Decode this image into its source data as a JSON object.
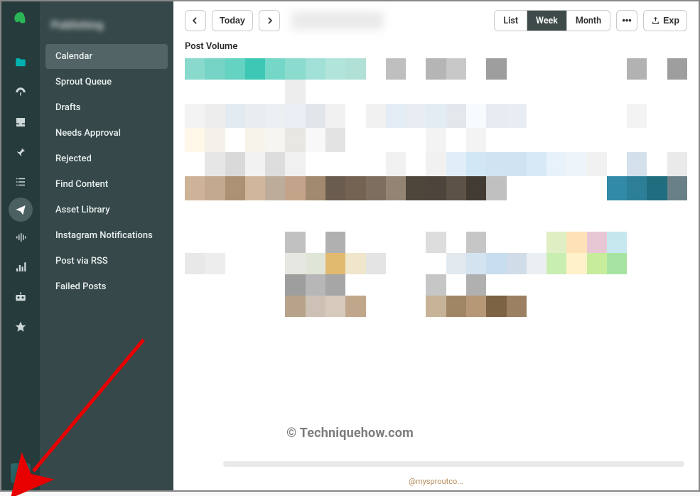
{
  "section_title": "Publishing",
  "sidebar": {
    "items": [
      {
        "label": "Calendar",
        "selected": true
      },
      {
        "label": "Sprout Queue"
      },
      {
        "label": "Drafts"
      },
      {
        "label": "Needs Approval"
      },
      {
        "label": "Rejected"
      },
      {
        "label": "Find Content"
      },
      {
        "label": "Asset Library"
      },
      {
        "label": "Instagram Notifications"
      },
      {
        "label": "Post via RSS"
      },
      {
        "label": "Failed Posts"
      }
    ]
  },
  "toolbar": {
    "today_label": "Today",
    "list_label": "List",
    "week_label": "Week",
    "month_label": "Month",
    "more_label": "•••",
    "export_label": "Exp"
  },
  "content": {
    "post_volume_label": "Post Volume",
    "footer_handle": "@mysproutco..."
  },
  "watermark": "© Techniquehow.com",
  "icon_rail": [
    "folder",
    "dashboard",
    "inbox",
    "pin",
    "list",
    "plane",
    "audio",
    "bars",
    "bot",
    "star"
  ],
  "pixels": [
    [
      "#8ad9cd",
      "#75d4c5",
      "#64d3c2",
      "#3cc8b4",
      "#74d7c8",
      "#8bdcce",
      "#a0e0d6",
      "#b1e4da",
      "#b1e0d6",
      "#ffffff",
      "#bfbfbf",
      "#ffffff",
      "#b5b5b5",
      "#c8c8c8",
      "#ffffff",
      "#9e9e9e",
      "#ffffff",
      "#ffffff",
      "#ffffff",
      "#ffffff",
      "#ffffff",
      "#ffffff",
      "#b2b2b2",
      "#ffffff",
      "#9e9e9e"
    ],
    [
      "#ffffff",
      "#ffffff",
      "#ffffff",
      "#ffffff",
      "#ffffff",
      "#ededed",
      "#ffffff",
      "#ffffff",
      "#ffffff",
      "#ffffff",
      "#ffffff",
      "#ffffff",
      "#ffffff",
      "#ffffff",
      "#ffffff",
      "#ffffff",
      "#ffffff",
      "#ffffff",
      "#ffffff",
      "#ffffff",
      "#ffffff",
      "#ffffff",
      "#ffffff",
      "#ffffff",
      "#ffffff"
    ],
    [
      "#f3f3f3",
      "#ededed",
      "#e2ebf2",
      "#e9edf1",
      "#edf0f2",
      "#e9eff4",
      "#e2e6ea",
      "#f1f1f1",
      "#ffffff",
      "#f1f1f1",
      "#e4edf5",
      "#e7edf2",
      "#e4ecf3",
      "#e3e8ed",
      "#f7fbfd",
      "#e6ecf1",
      "#e7edf2",
      "#ffffff",
      "#ffffff",
      "#ffffff",
      "#ffffff",
      "#ffffff",
      "#f3f3f3",
      "#ffffff",
      "#ffffff"
    ],
    [
      "#fff7e8",
      "#f4f0ea",
      "#ffffff",
      "#f7f3ea",
      "#f6f5f1",
      "#e8e7e3",
      "#f8f8f8",
      "#e3e3e3",
      "#ffffff",
      "#ffffff",
      "#ffffff",
      "#ffffff",
      "#f3f3f3",
      "#ffffff",
      "#f3f3f3",
      "#ffffff",
      "#ffffff",
      "#ffffff",
      "#ffffff",
      "#ffffff",
      "#ffffff",
      "#ffffff",
      "#ffffff",
      "#ffffff",
      "#ffffff"
    ],
    [
      "#ffffff",
      "#e6e6e6",
      "#d9d9d9",
      "#f2f2f2",
      "#dddddd",
      "#f0f0f0",
      "#ffffff",
      "#ffffff",
      "#ffffff",
      "#ffffff",
      "#f1f1f1",
      "#ffffff",
      "#f1f1f1",
      "#e1eef8",
      "#d2e7f6",
      "#cfe3f3",
      "#cfe3f3",
      "#d7e9f7",
      "#e8f2fb",
      "#eef5fa",
      "#f1f1f1",
      "#ffffff",
      "#d4e0eb",
      "#ffffff",
      "#eaeaea"
    ],
    [
      "#cfb399",
      "#c2a98f",
      "#ad9175",
      "#d0b79c",
      "#beac9a",
      "#c3a48a",
      "#a18a6f",
      "#6a5c4e",
      "#746252",
      "#7e6e5f",
      "#948473",
      "#4f463b",
      "#4d443b",
      "#5d5246",
      "#423b34",
      "#c0c0c0",
      "#ffffff",
      "#ffffff",
      "#ffffff",
      "#ffffff",
      "#ffffff",
      "#308aa8",
      "#2d7f98",
      "#206d7f",
      "#6a8087"
    ],
    [
      "#ffffff",
      "#ffffff",
      "#ffffff",
      "#ffffff",
      "#ffffff",
      "#ffffff",
      "#ffffff",
      "#ffffff",
      "#ffffff",
      "#ffffff",
      "#ffffff",
      "#ffffff",
      "#ffffff",
      "#ffffff",
      "#ffffff",
      "#ffffff",
      "#ffffff",
      "#ffffff",
      "#ffffff",
      "#ffffff",
      "#ffffff",
      "#ffffff",
      "#ffffff",
      "#ffffff",
      "#ffffff"
    ],
    [
      "#ffffff",
      "#ffffff",
      "#ffffff",
      "#ffffff",
      "#ffffff",
      "#c1c1c1",
      "#ffffff",
      "#b0b0b0",
      "#ffffff",
      "#ffffff",
      "#ffffff",
      "#ffffff",
      "#dddddd",
      "#ffffff",
      "#c6c6c6",
      "#ffffff",
      "#ffffff",
      "#ffffff",
      "#dfefc3",
      "#fce2b6",
      "#e8c7d4",
      "#c7e7ef",
      "#ffffff",
      "#ffffff",
      "#ffffff"
    ],
    [
      "#e8e8e8",
      "#ededed",
      "#ffffff",
      "#ffffff",
      "#ffffff",
      "#e6e7e1",
      "#e0e6d7",
      "#e1b96f",
      "#efe6cc",
      "#e4e4e4",
      "#ffffff",
      "#ffffff",
      "#ffffff",
      "#e1e8ee",
      "#d4e3f0",
      "#c8ddee",
      "#d0dde8",
      "#ebeff2",
      "#c9eeb2",
      "#fff1c9",
      "#c6ec9c",
      "#a7e4a1",
      "#ffffff",
      "#ffffff",
      "#ffffff"
    ],
    [
      "#ffffff",
      "#ffffff",
      "#ffffff",
      "#ffffff",
      "#ffffff",
      "#9e9e9e",
      "#b7b7b7",
      "#a6a6a6",
      "#ffffff",
      "#ffffff",
      "#ffffff",
      "#ffffff",
      "#c6c6c6",
      "#ffffff",
      "#b0b0b0",
      "#ffffff",
      "#ffffff",
      "#ffffff",
      "#ffffff",
      "#ffffff",
      "#ffffff",
      "#ffffff",
      "#ffffff",
      "#ffffff",
      "#ffffff"
    ],
    [
      "#ffffff",
      "#ffffff",
      "#ffffff",
      "#ffffff",
      "#ffffff",
      "#b7a38a",
      "#cdc1b6",
      "#d6cabc",
      "#c0a68a",
      "#ffffff",
      "#ffffff",
      "#ffffff",
      "#c7b397",
      "#a18665",
      "#b69876",
      "#7b6344",
      "#9b8061",
      "#ffffff",
      "#ffffff",
      "#ffffff",
      "#ffffff",
      "#ffffff",
      "#ffffff",
      "#ffffff",
      "#ffffff"
    ]
  ]
}
